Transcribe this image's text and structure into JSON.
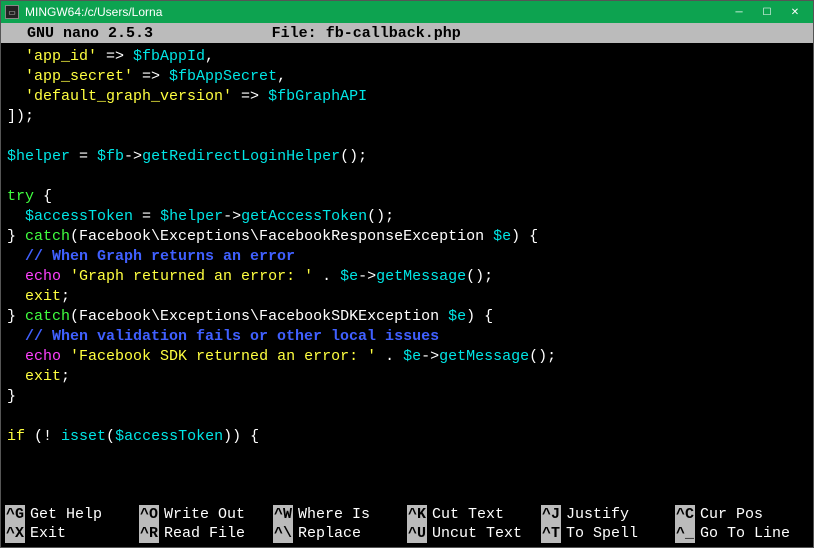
{
  "titlebar": {
    "title": "MINGW64:/c/Users/Lorna",
    "icon_label": "cmd"
  },
  "nano": {
    "app": "  GNU nano 2.5.3",
    "file_prefix": "File: ",
    "filename": "fb-callback.php"
  },
  "code": {
    "l01a": "  'app_id'",
    "l01b": " => ",
    "l01c": "$fbAppId",
    "l01d": ",",
    "l02a": "  'app_secret'",
    "l02b": " => ",
    "l02c": "$fbAppSecret",
    "l02d": ",",
    "l03a": "  'default_graph_version'",
    "l03b": " => ",
    "l03c": "$fbGraphAPI",
    "l04a": "]);",
    "l05a": "$helper",
    "l05b": " = ",
    "l05c": "$fb",
    "l05d": "->",
    "l05e": "getRedirectLoginHelper",
    "l05f": "();",
    "l06a": "try",
    "l06b": " {",
    "l07a": "  ",
    "l07b": "$accessToken",
    "l07c": " = ",
    "l07d": "$helper",
    "l07e": "->",
    "l07f": "getAccessToken",
    "l07g": "();",
    "l08a": "} ",
    "l08b": "catch",
    "l08c": "(Facebook\\Exceptions\\FacebookResponseException ",
    "l08d": "$e",
    "l08e": ") {",
    "l09a": "  // When Graph returns an error",
    "l10a": "  ",
    "l10b": "echo",
    "l10c": " 'Graph returned an error: '",
    "l10d": " . ",
    "l10e": "$e",
    "l10f": "->",
    "l10g": "getMessage",
    "l10h": "();",
    "l11a": "  ",
    "l11b": "exit",
    "l11c": ";",
    "l12a": "} ",
    "l12b": "catch",
    "l12c": "(Facebook\\Exceptions\\FacebookSDKException ",
    "l12d": "$e",
    "l12e": ") {",
    "l13a": "  // When validation fails or other local issues",
    "l14a": "  ",
    "l14b": "echo",
    "l14c": " 'Facebook SDK returned an error: '",
    "l14d": " . ",
    "l14e": "$e",
    "l14f": "->",
    "l14g": "getMessage",
    "l14h": "();",
    "l15a": "  ",
    "l15b": "exit",
    "l15c": ";",
    "l16a": "}",
    "l17a": "if",
    "l17b": " (! ",
    "l17c": "isset",
    "l17d": "(",
    "l17e": "$accessToken",
    "l17f": ")) {"
  },
  "shortcuts": {
    "row1": [
      {
        "key": "^G",
        "label": "Get Help"
      },
      {
        "key": "^O",
        "label": "Write Out"
      },
      {
        "key": "^W",
        "label": "Where Is"
      },
      {
        "key": "^K",
        "label": "Cut Text"
      },
      {
        "key": "^J",
        "label": "Justify"
      },
      {
        "key": "^C",
        "label": "Cur Pos"
      }
    ],
    "row2": [
      {
        "key": "^X",
        "label": "Exit"
      },
      {
        "key": "^R",
        "label": "Read File"
      },
      {
        "key": "^\\",
        "label": "Replace"
      },
      {
        "key": "^U",
        "label": "Uncut Text"
      },
      {
        "key": "^T",
        "label": "To Spell"
      },
      {
        "key": "^_",
        "label": "Go To Line"
      }
    ]
  }
}
